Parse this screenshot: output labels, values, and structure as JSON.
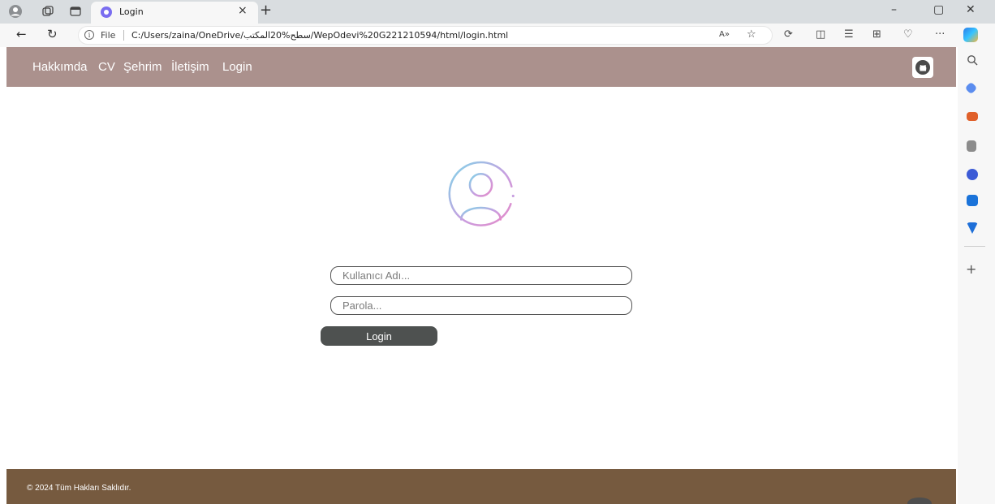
{
  "browser": {
    "tab_title": "Login",
    "tab_close": "×",
    "new_tab": "+",
    "window_controls": [
      "–",
      "▢",
      "✕"
    ],
    "back": "←",
    "refresh": "↻",
    "file_label": "File",
    "url": "C:/Users/zaina/OneDrive/سطح%20المكتب/WepOdevi%20G221210594/html/login.html",
    "read_aloud": "A»",
    "more": "···",
    "sidebar_add": "+"
  },
  "site": {
    "menu": [
      "Hakkımda",
      "CV",
      "Şehrim",
      "İletişim",
      "Login"
    ],
    "username_placeholder": "Kullanıcı Adı...",
    "password_placeholder": "Parola...",
    "login_button": "Login",
    "footer": "© 2024 Tüm Hakları Saklıdır."
  },
  "colors": {
    "nav_bg": "#ab918d",
    "footer_bg": "#765a3f",
    "button_bg": "#4e5150",
    "avatar_gradient": [
      "#7fd6e8",
      "#c79ee0",
      "#e58ac8"
    ]
  }
}
